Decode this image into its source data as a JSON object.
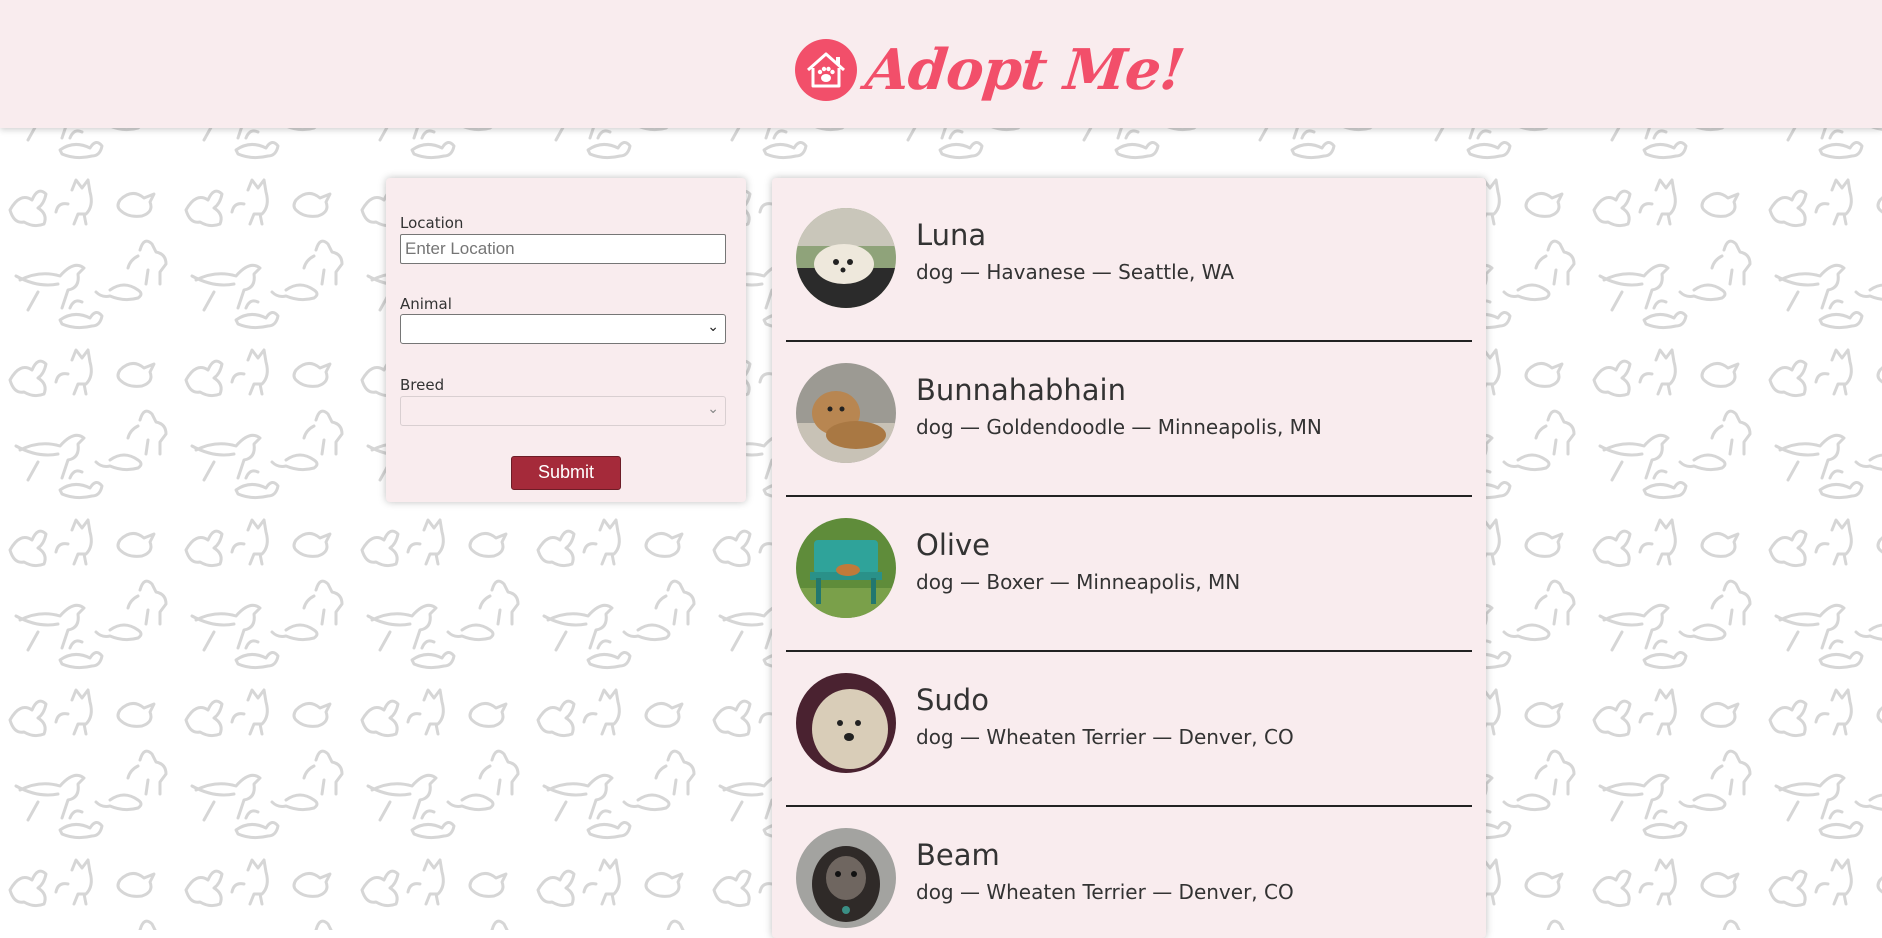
{
  "header": {
    "logo_text": "Adopt Me!",
    "accent_color": "#f24f6a"
  },
  "search": {
    "location_label": "Location",
    "location_placeholder": "Enter Location",
    "location_value": "",
    "animal_label": "Animal",
    "animal_value": "",
    "breed_label": "Breed",
    "breed_value": "",
    "submit_label": "Submit",
    "submit_color": "#a52a3a"
  },
  "pets": [
    {
      "name": "Luna",
      "info": "dog — Havanese — Seattle, WA"
    },
    {
      "name": "Bunnahabhain",
      "info": "dog — Goldendoodle — Minneapolis, MN"
    },
    {
      "name": "Olive",
      "info": "dog — Boxer — Minneapolis, MN"
    },
    {
      "name": "Sudo",
      "info": "dog — Wheaten Terrier — Denver, CO"
    },
    {
      "name": "Beam",
      "info": "dog — Wheaten Terrier — Denver, CO"
    }
  ],
  "icons": {
    "logo": "house-paw-icon",
    "select_arrow": "chevron-down-icon"
  }
}
